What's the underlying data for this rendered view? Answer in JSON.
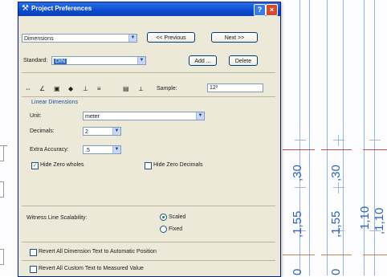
{
  "dialog": {
    "title": "Project Preferences",
    "help_glyph": "?",
    "close_glyph": "×",
    "category": "Dimensions",
    "previous_label": "<< Previous",
    "next_label": "Next >>",
    "standard_label": "Standard:",
    "standard_value": "DIN",
    "add_label": "Add ...",
    "delete_label": "Delete",
    "sample_label": "Sample:",
    "sample_value": "12³",
    "group_label": "Linear Dimensions",
    "unit_label": "Unit:",
    "unit_value": "meter",
    "decimals_label": "Decimals:",
    "decimals_value": "2",
    "extra_accuracy_label": "Extra Accuracy:",
    "extra_accuracy_value": ".5",
    "hide_zero_wholes_label": "Hide Zero wholes",
    "hide_zero_decimals_label": "Hide Zero Decimals",
    "witness_label": "Witness Line Scalability:",
    "scaled_label": "Scaled",
    "fixed_label": "Fixed",
    "revert_auto_label": "Revert All Dimension Text to Automatic Position",
    "revert_custom_label": "Revert All Custom Text to Measured Value"
  },
  "toolbar_icons": [
    "unit-icon",
    "angle-icon",
    "area-icon",
    "level-icon",
    "height-icon",
    "text-style-icon",
    "dimension-style-icon",
    "marker-icon"
  ],
  "drawing": {
    "dimensions": [
      "0",
      ",1,55",
      ",30",
      "0",
      ",1,55",
      ",30",
      "1,10",
      ",1,10"
    ]
  },
  "colors": {
    "title_bar": "#0b4bcf",
    "selection": "#316ac5",
    "dimension_text": "#2f64b8",
    "marker_red": "#d04848",
    "grid_line": "#8db4e6"
  }
}
